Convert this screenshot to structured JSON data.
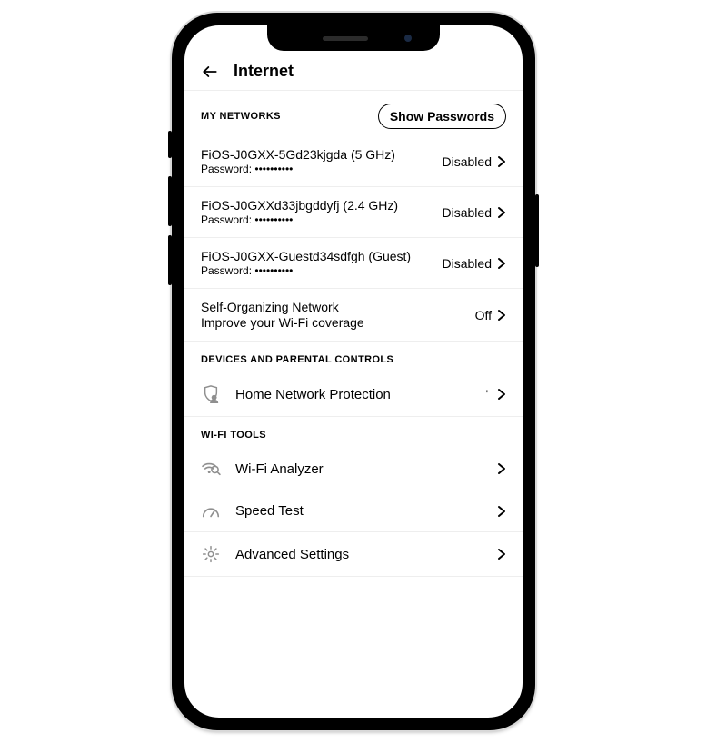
{
  "header": {
    "title": "Internet"
  },
  "sections": {
    "my_networks_label": "MY NETWORKS",
    "show_passwords_label": "Show Passwords",
    "networks": [
      {
        "name": "FiOS-J0GXX-5Gd23kjgda (5 GHz)",
        "password_label": "Password:",
        "password_mask": "••••••••••",
        "status": "Disabled"
      },
      {
        "name": "FiOS-J0GXXd33jbgddyfj (2.4 GHz)",
        "password_label": "Password:",
        "password_mask": "••••••••••",
        "status": "Disabled"
      },
      {
        "name": "FiOS-J0GXX-Guestd34sdfgh (Guest)",
        "password_label": "Password:",
        "password_mask": "••••••••••",
        "status": "Disabled"
      }
    ],
    "son": {
      "title": "Self-Organizing Network",
      "subtitle": "Improve your Wi-Fi coverage",
      "status": "Off"
    },
    "devices_label": "DEVICES AND PARENTAL CONTROLS",
    "home_network_protection_label": "Home Network Protection",
    "wifi_tools_label": "WI-FI TOOLS",
    "tools": {
      "analyzer": "Wi-Fi Analyzer",
      "speed_test": "Speed Test",
      "advanced": "Advanced Settings"
    }
  }
}
